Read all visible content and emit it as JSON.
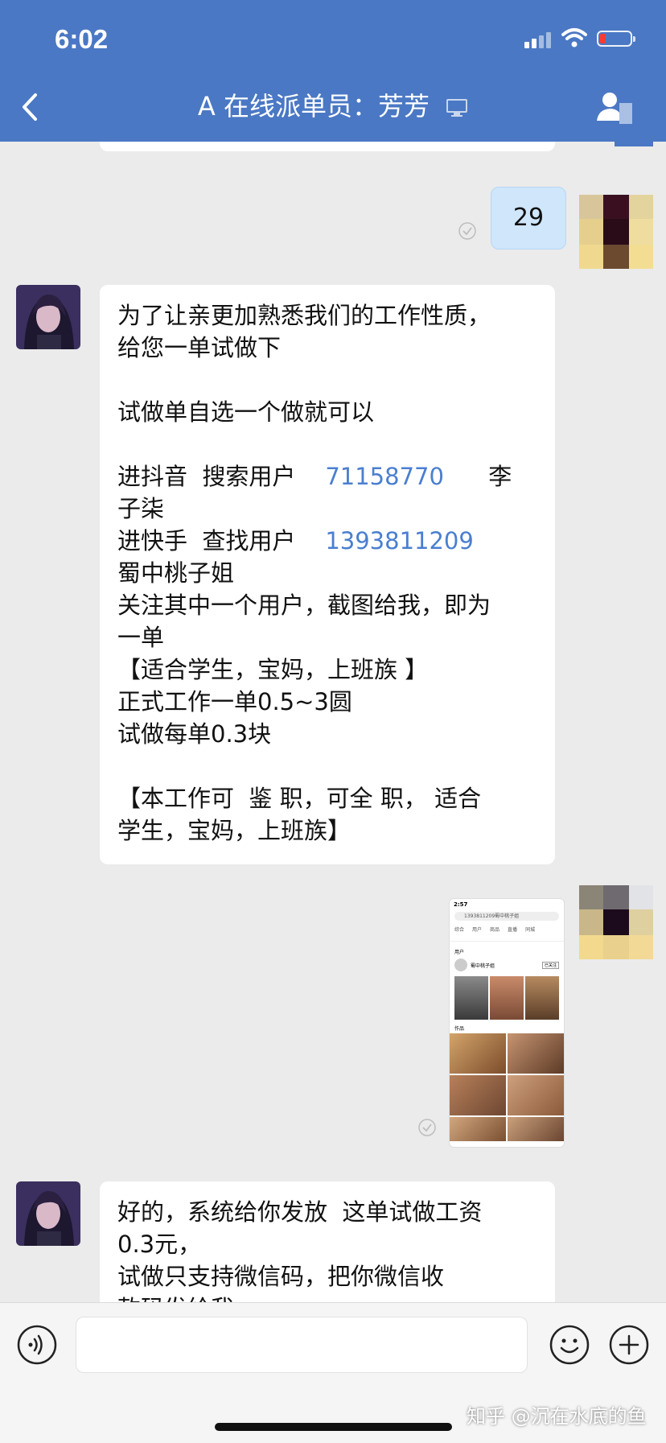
{
  "status_bar": {
    "time": "6:02"
  },
  "header": {
    "title": "A 在线派单员：芳芳",
    "title_color": "#4a78c4"
  },
  "messages": [
    {
      "side": "out",
      "type": "text",
      "text": "29"
    },
    {
      "side": "in",
      "type": "text",
      "lines": {
        "l1": "为了让亲更加熟悉我们的工作性质，",
        "l2": "给您一单试做下",
        "l3": "试做单自选一个做就可以",
        "l4a": "进抖音  搜索用户    ",
        "l4link": "71158770",
        "l4b": "      李",
        "l5": "子柒",
        "l6a": "进快手  查找用户    ",
        "l6link": "1393811209",
        "l7": "蜀中桃子姐",
        "l8": "关注其中一个用户，截图给我，即为",
        "l9": "一单",
        "l10": "【适合学生，宝妈，上班族 】",
        "l11": "正式工作一单0.5~3圆",
        "l12": "试做每单0.3块",
        "l13": "【本工作可  鉴 职，可全 职， 适合",
        "l14": "学生，宝妈，上班族】"
      }
    },
    {
      "side": "out",
      "type": "image",
      "screenshot": {
        "time": "2:57",
        "search_text": "1393811209蜀中桃子姐",
        "tabs": [
          "综合",
          "用户",
          "商品",
          "直播",
          "同城"
        ],
        "section_user": "用户",
        "user_name": "蜀中桃子姐",
        "follow": "已关注",
        "section_works": "作品"
      }
    },
    {
      "side": "in",
      "type": "text",
      "lines": {
        "l1": "好的，系统给你发放  这单试做工资",
        "l2": "0.3元，",
        "l3": "试做只支持微信码，把你微信收",
        "l4": "款码发给我"
      }
    }
  ],
  "watermark": "知乎 @沉在水底的鱼"
}
